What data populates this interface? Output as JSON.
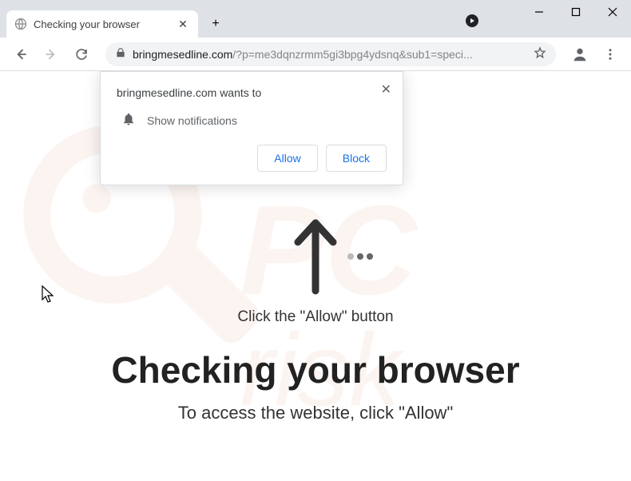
{
  "tab": {
    "title": "Checking your browser"
  },
  "url": {
    "host": "bringmesedline.com",
    "rest": "/?p=me3dqnzrmm5gi3bpg4ydsnq&sub1=speci..."
  },
  "permission": {
    "site": "bringmesedline.com",
    "wants_to": "wants to",
    "show_notifications": "Show notifications",
    "allow": "Allow",
    "block": "Block"
  },
  "page": {
    "click_allow": "Click the \"Allow\" button",
    "heading": "Checking your browser",
    "subtext": "To access the website, click \"Allow\""
  },
  "watermark": {
    "text": "PCrisk"
  }
}
